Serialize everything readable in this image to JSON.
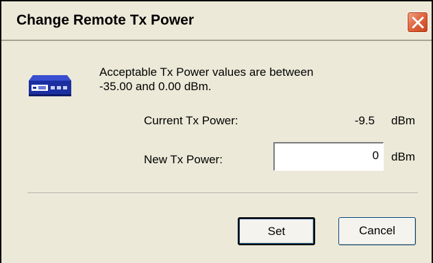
{
  "window": {
    "title": "Change Remote Tx Power"
  },
  "info": {
    "line1": "Acceptable Tx Power values are between",
    "line2": "-35.00 and 0.00 dBm."
  },
  "current_tx": {
    "label": "Current Tx Power:",
    "value": "-9.5",
    "unit": "dBm"
  },
  "new_tx": {
    "label": "New Tx Power:",
    "value": "0",
    "unit": "dBm"
  },
  "buttons": {
    "set_label": "Set",
    "cancel_label": "Cancel"
  },
  "icons": {
    "device": "network-device-icon",
    "close": "close-icon"
  },
  "colors": {
    "dialog_background": "#ECE9D8",
    "close_button": "#E16A44",
    "device_body": "#1B2FA0"
  }
}
